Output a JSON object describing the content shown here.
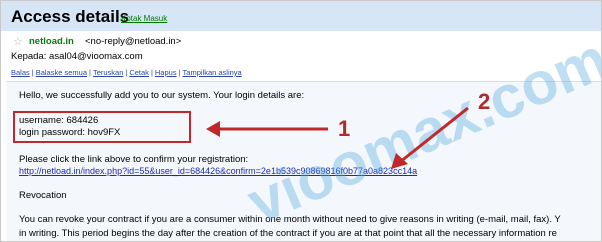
{
  "header": {
    "title": "Access details",
    "label": "Kotak Masuk"
  },
  "message": {
    "sender_name": "netload.in",
    "sender_address": "<no-reply@netload.in>",
    "recipient": "Kepada: asal04@vioomax.com"
  },
  "actions": {
    "reply": "Balas",
    "reply_all": "Balaske semua",
    "forward": "Teruskan",
    "print": "Cetak",
    "delete": "Hapus",
    "show_original": "Tampilkan aslinya"
  },
  "body": {
    "greeting": "Hello, we successfully add you to our system. Your login details are:",
    "username": "username: 684426",
    "password": "login password: hov9FX",
    "confirm_text": "Please click the link above to confirm your registration:",
    "confirm_url": "http://netload.in/index.php?id=55&user_id=684426&confirm=2e1b539c90869816f0b77a0a823cc14a",
    "revocation": "Revocation",
    "revocation_text1": "You can revoke your contract if you are a consumer within one month without need to give reasons in writing (e-mail, mail, fax). Y",
    "revocation_text2": "in writing. This period begins the day after the creation of the contract if you are at that point that all the necessary information re"
  },
  "annotations": {
    "marker_1": "1",
    "marker_2": "2",
    "watermark": "vioomax.com",
    "accent_color": "#c0282c"
  }
}
